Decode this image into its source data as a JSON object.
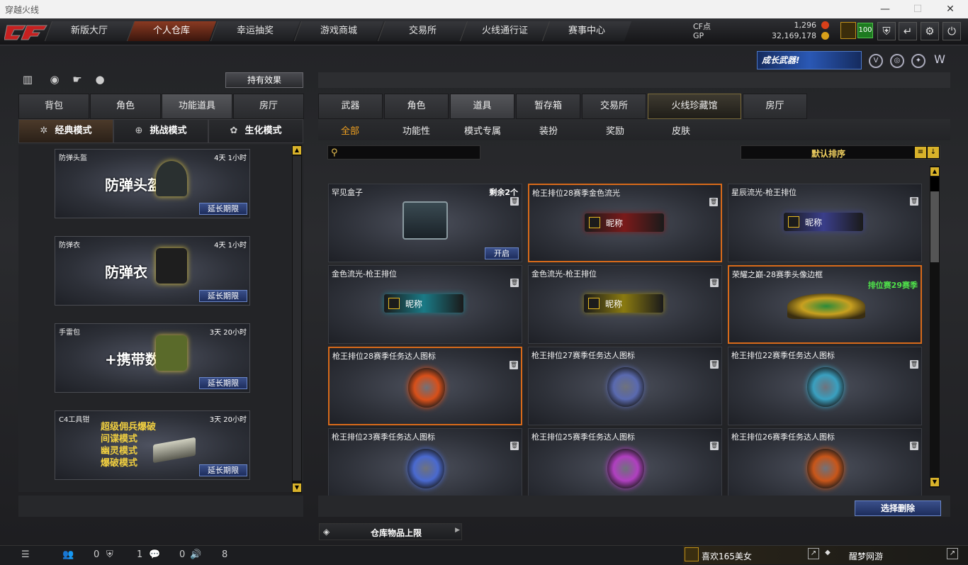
{
  "window": {
    "title": "穿越火线",
    "minimize": "—",
    "maximize": "☐",
    "close": "✕"
  },
  "nav": {
    "tabs": [
      "新版大厅",
      "个人仓库",
      "幸运抽奖",
      "游戏商城",
      "交易所",
      "火线通行证",
      "赛事中心"
    ],
    "active_index": 1
  },
  "currency": {
    "cf_label": "CF点",
    "cf_value": "1,296",
    "gp_label": "GP",
    "gp_value": "32,169,178"
  },
  "level": {
    "value": "100"
  },
  "top_buttons": [
    {
      "icon": "mask-icon"
    },
    {
      "icon": "return-icon"
    },
    {
      "icon": "gear-icon"
    },
    {
      "icon": "power-icon"
    }
  ],
  "banner": {
    "text": "成长武器!"
  },
  "left": {
    "effect_button": "持有效果",
    "tabs": [
      "背包",
      "角色",
      "功能道具",
      "房厅"
    ],
    "active_tab": 2,
    "modes": [
      "经典模式",
      "挑战模式",
      "生化模式"
    ],
    "active_mode": 0,
    "items": [
      {
        "name": "防弹头盔",
        "time": "4天 1小时",
        "big": "防弹头盔",
        "button": "延长期限"
      },
      {
        "name": "防弹衣",
        "time": "4天 1小时",
        "big": "防弹衣",
        "button": "延长期限"
      },
      {
        "name": "手雷包",
        "time": "3天 20小时",
        "big": "+携带数",
        "button": "延长期限"
      },
      {
        "name": "C4工具钳",
        "time": "3天 20小时",
        "big_lines": [
          "超级佣兵爆破",
          "间谍模式",
          "幽灵模式",
          "爆破模式"
        ],
        "button": "延长期限"
      }
    ]
  },
  "right": {
    "tabs": [
      "武器",
      "角色",
      "道具",
      "暂存箱",
      "交易所",
      "火线珍藏馆",
      "房厅"
    ],
    "active_tab": 5,
    "subtabs": [
      "全部",
      "功能性",
      "模式专属",
      "装扮",
      "奖励",
      "皮肤"
    ],
    "active_subtab": 0,
    "search_placeholder": "",
    "sort_label": "默认排序",
    "items": [
      {
        "name": "罕见盒子",
        "right": "剩余2个",
        "action": "开启",
        "kind": "box"
      },
      {
        "name": "枪王排位28赛季金色流光",
        "kind": "plate",
        "plate_text": "昵称",
        "color": "#7a1a1a",
        "highlight": true
      },
      {
        "name": "星辰流光-枪王排位",
        "kind": "plate",
        "plate_text": "昵称",
        "color": "#3a3e8a"
      },
      {
        "name": "金色流光-枪王排位",
        "kind": "plate",
        "plate_text": "昵称",
        "color": "#1a7a86"
      },
      {
        "name": "金色流光-枪王排位",
        "kind": "plate",
        "plate_text": "昵称",
        "color": "#8a7a10"
      },
      {
        "name": "荣耀之巅-28赛季头像边框",
        "badge": "排位赛29赛季",
        "kind": "frame",
        "highlight": true
      },
      {
        "name": "枪王排位28赛季任务达人图标",
        "kind": "emblem",
        "color": "#d8501a",
        "highlight": true
      },
      {
        "name": "枪王排位27赛季任务达人图标",
        "kind": "emblem",
        "color": "#5a6ab0"
      },
      {
        "name": "枪王排位22赛季任务达人图标",
        "kind": "emblem",
        "color": "#3aa0c0"
      },
      {
        "name": "枪王排位23赛季任务达人图标",
        "kind": "emblem",
        "color": "#4a6ad0"
      },
      {
        "name": "枪王排位25赛季任务达人图标",
        "kind": "emblem",
        "color": "#b040c0"
      },
      {
        "name": "枪王排位26赛季任务达人图标",
        "kind": "emblem",
        "color": "#c8561a"
      }
    ],
    "delete_button": "选择删除",
    "capacity_label": "仓库物品上限"
  },
  "status": {
    "friends": "0",
    "shield": "1",
    "chat": "0",
    "volume": "8",
    "username": "喜欢165美女",
    "game_name": "醒梦网游"
  }
}
